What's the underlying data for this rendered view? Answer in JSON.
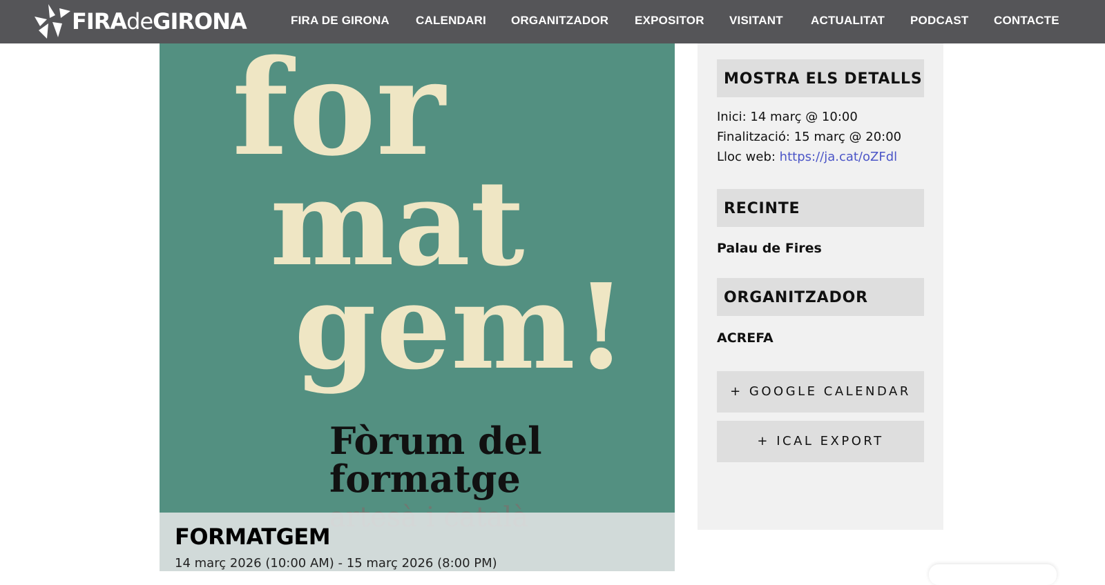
{
  "header": {
    "logo_text_a": "FIRA",
    "logo_text_b": "de",
    "logo_text_c": "GIRONA",
    "nav": [
      "FIRA DE GIRONA",
      "CALENDARI",
      "ORGANITZADOR",
      "EXPOSITOR",
      "VISITANT",
      "ACTUALITAT",
      "PODCAST",
      "CONTACTE"
    ]
  },
  "poster": {
    "line1": "for",
    "line2": "mat",
    "line3": "gem!",
    "sub1": "Fòrum del",
    "sub2": "formatge",
    "sub3": "artesà i català"
  },
  "event": {
    "title": "FORMATGEM",
    "dates": "14 març 2026 (10:00 AM) - 15 març 2026 (8:00 PM)"
  },
  "sidebar": {
    "details_heading": "MOSTRA ELS DETALLS",
    "start": "Inici: 14 març @ 10:00",
    "end": "Finalització: 15 març @ 20:00",
    "web_label": "Lloc web: ",
    "web_link": "https://ja.cat/oZFdl",
    "venue_heading": "RECINTE",
    "venue": "Palau de Fires",
    "organizer_heading": "ORGANITZADOR",
    "organizer": "ACREFA",
    "google_button": "+ GOOGLE CALENDAR",
    "ical_button": "+ ICAL EXPORT"
  },
  "colors": {
    "header_bg": "#555558",
    "poster_bg": "#539081",
    "poster_text": "#efe6c4",
    "link": "#4b55c7",
    "sidebar_bg": "#f1f1f1",
    "panel_bg": "#dedede"
  }
}
